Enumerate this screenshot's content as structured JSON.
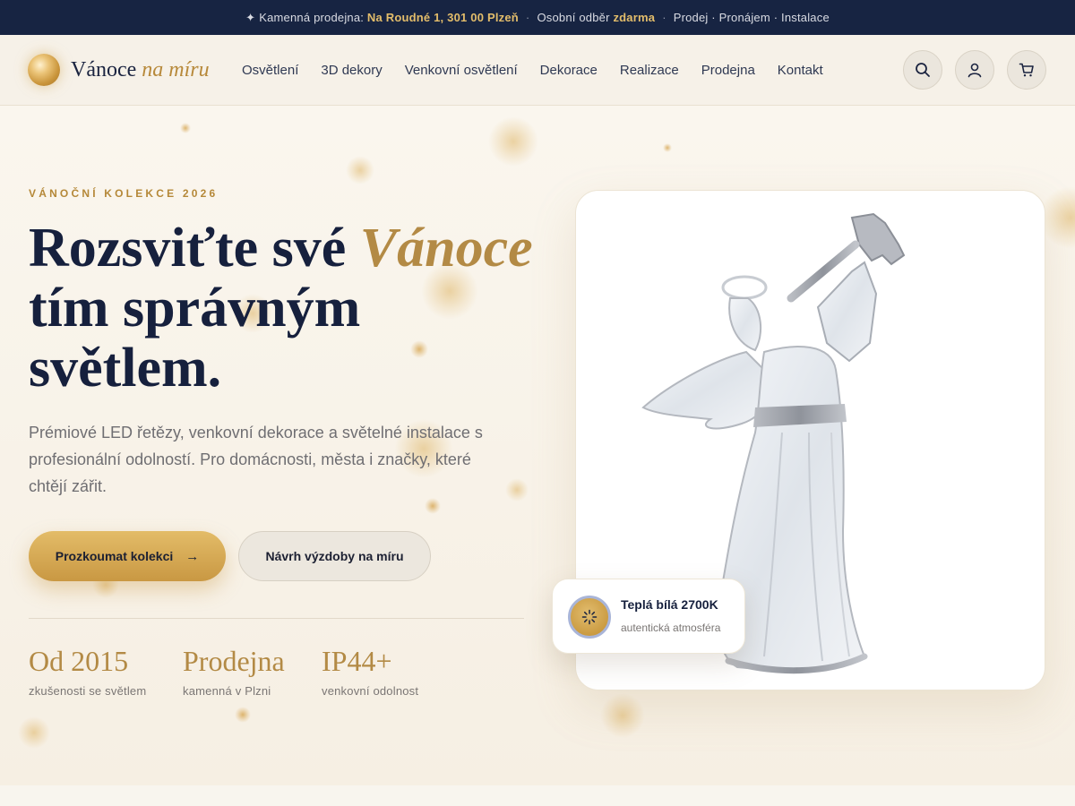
{
  "topbar": {
    "star": "✦",
    "store_label": "Kamenná prodejna:",
    "store_address": "Na Roudné 1, 301 00 Plzeň",
    "sep1": "·",
    "pickup_label": "Osobní odběr",
    "pickup_value": "zdarma",
    "sep2": "·",
    "services": "Prodej · Pronájem · Instalace"
  },
  "header": {
    "logo_main": "Vánoce",
    "logo_accent": "na míru",
    "nav": [
      "Osvětlení",
      "3D dekory",
      "Venkovní osvětlení",
      "Dekorace",
      "Realizace",
      "Prodejna",
      "Kontakt"
    ],
    "icons": {
      "search": "search-icon",
      "account": "user-icon",
      "cart": "cart-icon"
    }
  },
  "hero": {
    "eyebrow": "VÁNOČNÍ KOLEKCE 2026",
    "headline_part1": "Rozsviťte své",
    "headline_accent": "Vánoce",
    "headline_part2": "tím správným",
    "headline_part3": "světlem.",
    "lede": "Prémiové LED řetězy, venkovní dekorace a světelné instalace s profesionální odolností. Pro domácnosti, města i značky, které chtějí zářit.",
    "primary_cta": "Prozkoumat kolekci",
    "primary_cta_icon": "→",
    "secondary_cta": "Návrh výzdoby na míru",
    "stats": [
      {
        "value": "Od 2015",
        "label": "zkušenosti se světlem"
      },
      {
        "value": "Prodejna",
        "label": "kamenná v Plzni"
      },
      {
        "value": "IP44+",
        "label": "venkovní odolnost"
      }
    ]
  },
  "product_badge": {
    "title": "Teplá bílá 2700K",
    "subtitle": "autentická atmosféra"
  },
  "colors": {
    "navy": "#172442",
    "gold": "#b38a45",
    "cream": "#f8f3ea"
  }
}
